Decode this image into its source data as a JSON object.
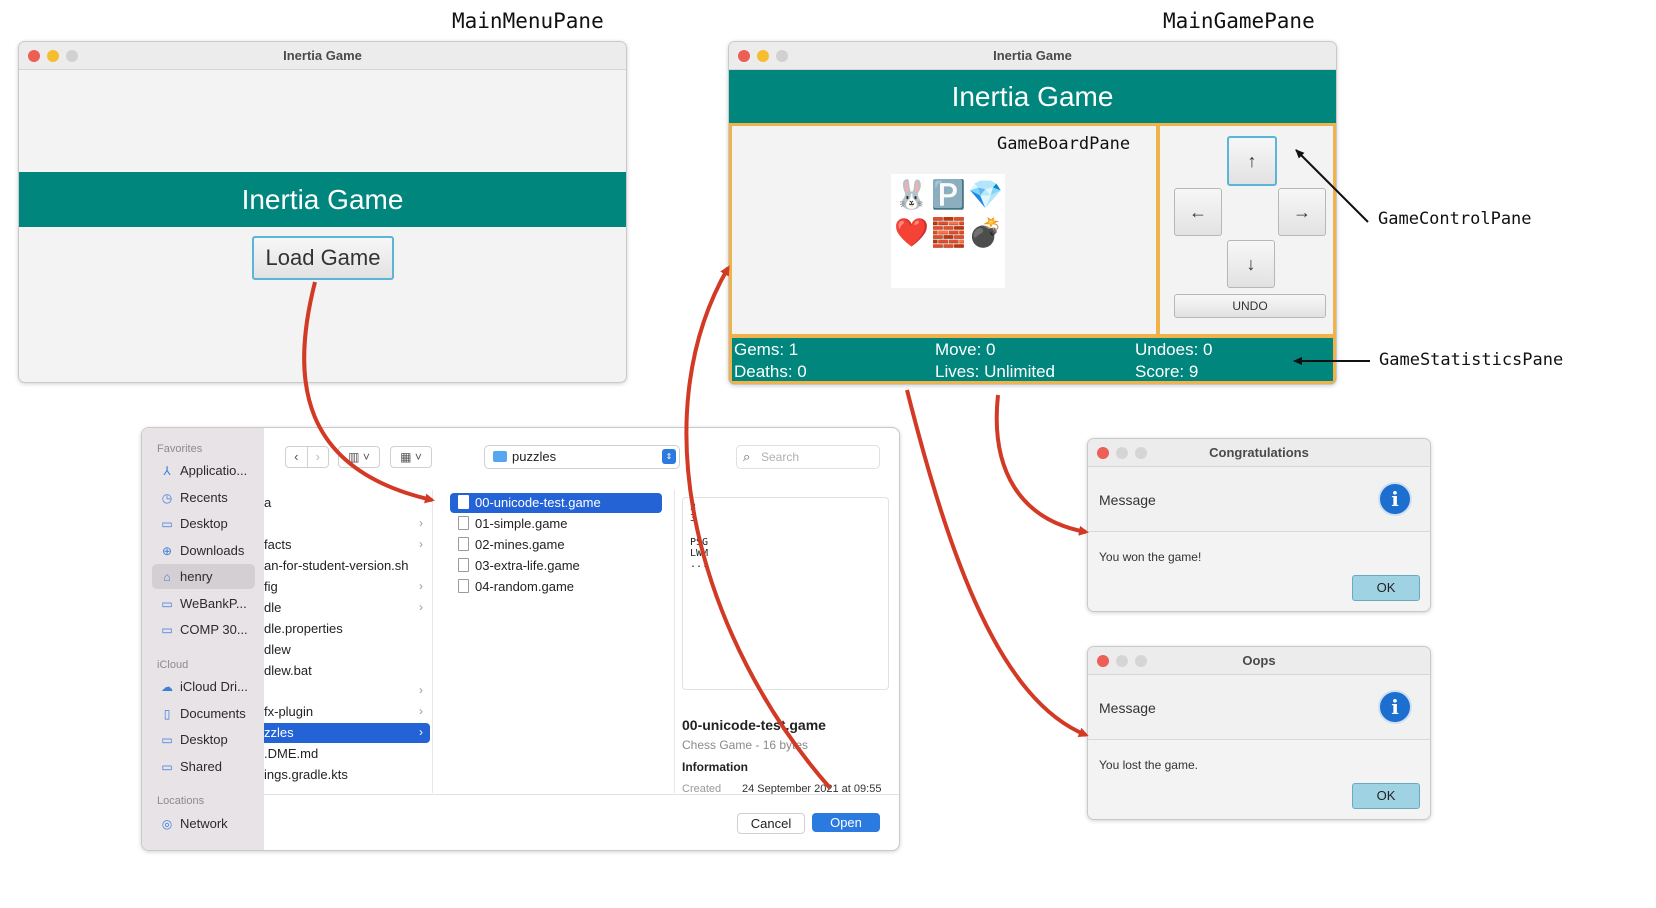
{
  "labels": {
    "main_menu_pane": "MainMenuPane",
    "main_game_pane": "MainGamePane",
    "game_board_pane": "GameBoardPane",
    "game_control_pane": "GameControlPane",
    "game_statistics_pane": "GameStatisticsPane"
  },
  "main_menu": {
    "window_title": "Inertia Game",
    "banner": "Inertia Game",
    "load_button": "Load Game"
  },
  "main_game": {
    "window_title": "Inertia Game",
    "banner": "Inertia Game",
    "board_row1": [
      "🐰",
      "🅿️",
      "💎"
    ],
    "board_row2": [
      "❤️",
      "🧱",
      "💣"
    ],
    "controls": {
      "up": "↑",
      "left": "←",
      "right": "→",
      "down": "↓",
      "undo": "UNDO"
    },
    "stats": {
      "gems": "Gems: 1",
      "deaths": "Deaths: 0",
      "move": "Move: 0",
      "lives": "Lives: Unlimited",
      "undoes": "Undoes: 0",
      "score": "Score: 9"
    }
  },
  "file_dialog": {
    "location": "puzzles",
    "search_placeholder": "Search",
    "sidebar": {
      "favorites_title": "Favorites",
      "favorites": [
        "Applicatio...",
        "Recents",
        "Desktop",
        "Downloads",
        "henry",
        "WeBankP...",
        "COMP 30..."
      ],
      "icloud_title": "iCloud",
      "icloud": [
        "iCloud Dri...",
        "Documents",
        "Desktop",
        "Shared"
      ],
      "locations_title": "Locations",
      "locations": [
        "Network"
      ]
    },
    "column1": [
      "a",
      "",
      "facts",
      "an-for-student-version.sh",
      "fig",
      "dle",
      "dle.properties",
      "dlew",
      "dlew.bat",
      "",
      "fx-plugin",
      "zzles",
      ".DME.md",
      "ings.gradle.kts"
    ],
    "column2": [
      "00-unicode-test.game",
      "01-simple.game",
      "02-mines.game",
      "03-extra-life.game",
      "04-random.game"
    ],
    "preview_lines": [
      "3",
      "3",
      "",
      "PSG",
      "LWM",
      "..."
    ],
    "preview_name": "00-unicode-test.game",
    "preview_kind": "Chess Game - 16 bytes",
    "info_title": "Information",
    "created_label": "Created",
    "created_value": "24 September 2021 at 09:55",
    "cancel": "Cancel",
    "open": "Open"
  },
  "dialog_win": {
    "title": "Congratulations",
    "header": "Message",
    "message": "You won the game!",
    "ok": "OK"
  },
  "dialog_lose": {
    "title": "Oops",
    "header": "Message",
    "message": "You lost the game.",
    "ok": "OK"
  },
  "colors": {
    "teal": "#00867d",
    "orange_outline": "#f0b24a",
    "arrow_red": "#d23a25",
    "selection_blue": "#2463d6"
  }
}
